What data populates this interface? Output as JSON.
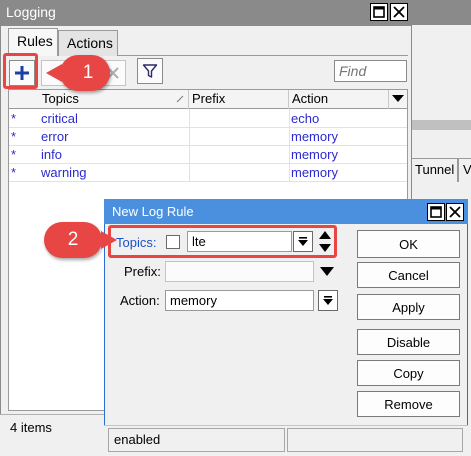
{
  "background_window": {
    "tabs": [
      "Tunnel",
      "V"
    ]
  },
  "logging_window": {
    "title": "Logging",
    "tabs": [
      "Rules",
      "Actions"
    ],
    "find_placeholder": "Find",
    "columns": [
      "Topics",
      "Prefix",
      "Action"
    ],
    "rows": [
      {
        "marker": "*",
        "topics": "critical",
        "prefix": "",
        "action": "echo"
      },
      {
        "marker": "*",
        "topics": "error",
        "prefix": "",
        "action": "memory"
      },
      {
        "marker": "*",
        "topics": "info",
        "prefix": "",
        "action": "memory"
      },
      {
        "marker": "*",
        "topics": "warning",
        "prefix": "",
        "action": "memory"
      }
    ],
    "status": "4 items"
  },
  "callouts": {
    "step1": "1",
    "step2": "2"
  },
  "dialog": {
    "title": "New Log Rule",
    "topics_label": "Topics:",
    "topics_value": "lte",
    "prefix_label": "Prefix:",
    "prefix_value": "",
    "action_label": "Action:",
    "action_value": "memory",
    "buttons": {
      "ok": "OK",
      "cancel": "Cancel",
      "apply": "Apply",
      "disable": "Disable",
      "copy": "Copy",
      "remove": "Remove"
    },
    "status": "enabled"
  },
  "colors": {
    "accent_red": "#e84545",
    "link_blue": "#2a2ad0",
    "dialog_title_bg": "#4b90df",
    "inactive_title_bg": "#8a8a8a"
  },
  "icons": {
    "add": "plus-icon",
    "remove": "minus-icon",
    "disable": "x-icon",
    "filter": "funnel-icon",
    "maximize": "maximize-icon",
    "close": "close-icon",
    "dropdown": "chevron-down-icon",
    "updown": "up-down-arrows-icon"
  }
}
